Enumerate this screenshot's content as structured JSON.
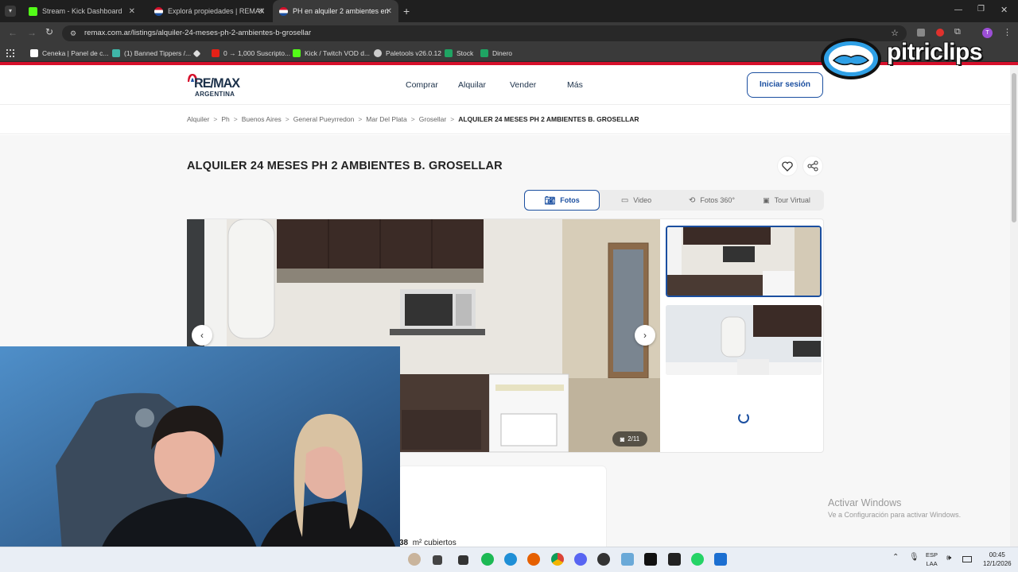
{
  "browser": {
    "tabs": [
      {
        "title": "Stream - Kick Dashboard"
      },
      {
        "title": "Explorá propiedades | REMAX"
      },
      {
        "title": "PH en alquiler 2 ambientes en"
      }
    ],
    "url": "remax.com.ar/listings/alquiler-24-meses-ph-2-ambientes-b-grosellar",
    "bookmarks": [
      {
        "label": "Ceneka | Panel de c..."
      },
      {
        "label": "(1) Banned Tippers /..."
      },
      {
        "label": ""
      },
      {
        "label": "0 → 1,000 Suscripto..."
      },
      {
        "label": "Kick / Twitch VOD d..."
      },
      {
        "label": "Paletools v26.0.12"
      },
      {
        "label": "Stock"
      },
      {
        "label": "Dinero"
      }
    ]
  },
  "overlay": {
    "brand": "pitriclips"
  },
  "site": {
    "logo_main": "RE/MAX",
    "logo_sub": "ARGENTINA",
    "nav": [
      "Comprar",
      "Alquilar",
      "Vender",
      "Más"
    ],
    "login": "Iniciar sesión",
    "breadcrumbs": [
      "Alquiler",
      "Ph",
      "Buenos Aires",
      "General Pueyrredon",
      "Mar Del Plata",
      "Grosellar"
    ],
    "breadcrumb_current": "ALQUILER 24 MESES PH 2 AMBIENTES B. GROSELLAR",
    "title": "ALQUILER 24 MESES PH 2 AMBIENTES B. GROSELLAR",
    "media_tabs": [
      "Fotos",
      "Video",
      "Fotos 360°",
      "Tour Virtual"
    ],
    "photo_counter": "2/11",
    "m2_value": "38",
    "m2_label": "m² cubiertos"
  },
  "windows": {
    "activate_title": "Activar Windows",
    "activate_sub": "Ve a Configuración para activar Windows."
  },
  "taskbar": {
    "lang1": "ESP",
    "lang2": "LAA",
    "time": "00:45",
    "date": "12/1/2026"
  }
}
